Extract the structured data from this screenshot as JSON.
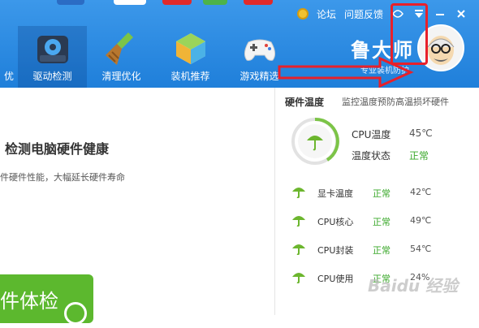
{
  "topbar": {
    "forum": "论坛",
    "feedback": "问题反馈"
  },
  "nav": {
    "first_label": "优",
    "items": [
      {
        "label": "驱动检测",
        "icon": "gear-cube-icon",
        "active": true
      },
      {
        "label": "清理优化",
        "icon": "broom-icon"
      },
      {
        "label": "装机推荐",
        "icon": "cube-icon"
      },
      {
        "label": "游戏精选",
        "icon": "gamepad-icon"
      }
    ]
  },
  "brand": {
    "name": "鲁大师",
    "subtitle": "专业装机防护"
  },
  "left": {
    "headline": "检测电脑硬件健康",
    "subline": "件硬件性能，大幅延长硬件寿命",
    "check_button": "件体检"
  },
  "panel": {
    "title": "硬件温度",
    "desc": "监控温度预防高温损坏硬件",
    "cpu_temp_label": "CPU温度",
    "cpu_temp_value": "45℃",
    "temp_status_label": "温度状态",
    "temp_status_value": "正常",
    "rows": [
      {
        "label": "显卡温度",
        "status": "正常",
        "value": "42℃"
      },
      {
        "label": "CPU核心",
        "status": "正常",
        "value": "49℃"
      },
      {
        "label": "CPU封装",
        "status": "正常",
        "value": "54℃"
      },
      {
        "label": "CPU使用",
        "status": "正常",
        "value": "24%"
      }
    ]
  },
  "watermark": "Baidu 经验",
  "colors": {
    "header": "#2d8ae0",
    "ok_green": "#3aa82a",
    "button_green": "#5cb82e",
    "annotation_red": "#e8202a"
  }
}
